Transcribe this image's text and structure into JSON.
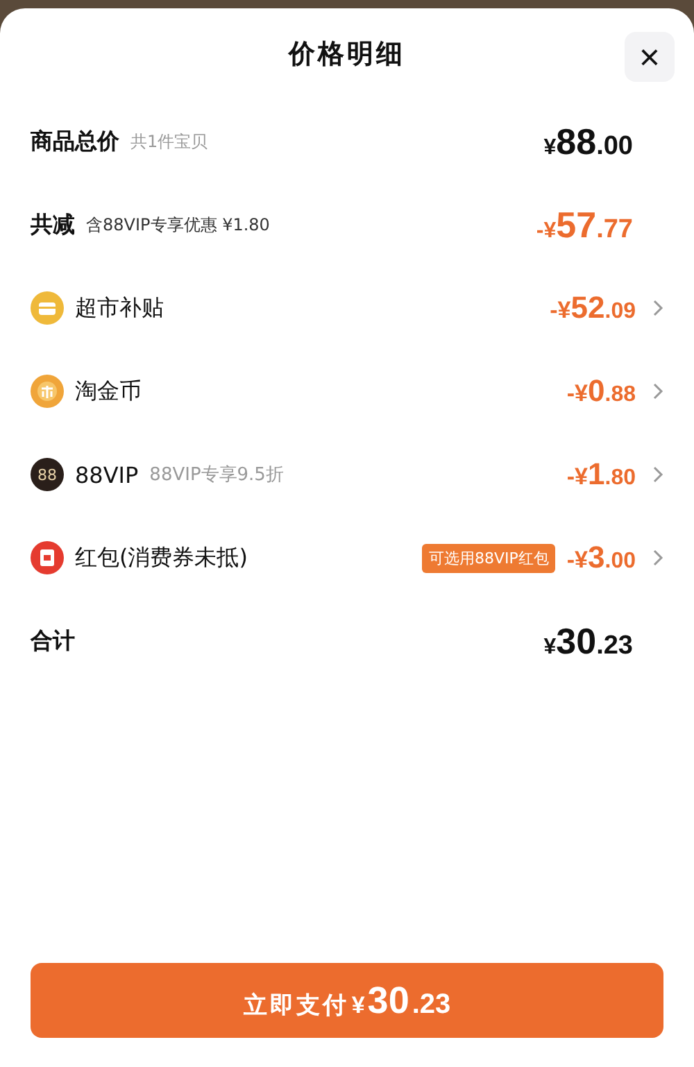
{
  "sheet": {
    "title": "价格明细",
    "close": "×"
  },
  "rows": [
    {
      "kind": "summary",
      "label": "商品总价",
      "note": "共1件宝贝",
      "price": {
        "sign": "¥",
        "integer": "88",
        "decimal": ".00"
      },
      "discount": false,
      "arrow": false
    },
    {
      "kind": "summary",
      "label": "共减",
      "note": "含88VIP专享优惠 ¥1.80",
      "price": {
        "sign": "-¥",
        "integer": "57",
        "decimal": ".77"
      },
      "discount": true,
      "arrow": false
    },
    {
      "kind": "subsidy",
      "label": "超市补贴",
      "price": {
        "sign": "-¥",
        "integer": "52",
        "decimal": ".09"
      },
      "discount": true,
      "arrow": true
    },
    {
      "kind": "coin",
      "label": "淘金币",
      "price": {
        "sign": "-¥",
        "integer": "0",
        "decimal": ".88"
      },
      "discount": true,
      "arrow": true
    },
    {
      "kind": "vip",
      "icon_text": "88",
      "label": "88VIP",
      "note": "88VIP专享9.5折",
      "price": {
        "sign": "-¥",
        "integer": "1",
        "decimal": ".80"
      },
      "discount": true,
      "arrow": true
    },
    {
      "kind": "packet",
      "label": "红包(消费券未抵)",
      "tag": "可选用88VIP红包",
      "price": {
        "sign": "-¥",
        "integer": "3",
        "decimal": ".00"
      },
      "discount": true,
      "arrow": true
    },
    {
      "kind": "summary",
      "label": "合计",
      "price": {
        "sign": "¥",
        "integer": "30",
        "decimal": ".23"
      },
      "discount": false,
      "arrow": false
    }
  ],
  "pay_button": {
    "label": "立即支付",
    "price": {
      "sign": "¥",
      "integer": "30",
      "decimal": ".23"
    }
  }
}
